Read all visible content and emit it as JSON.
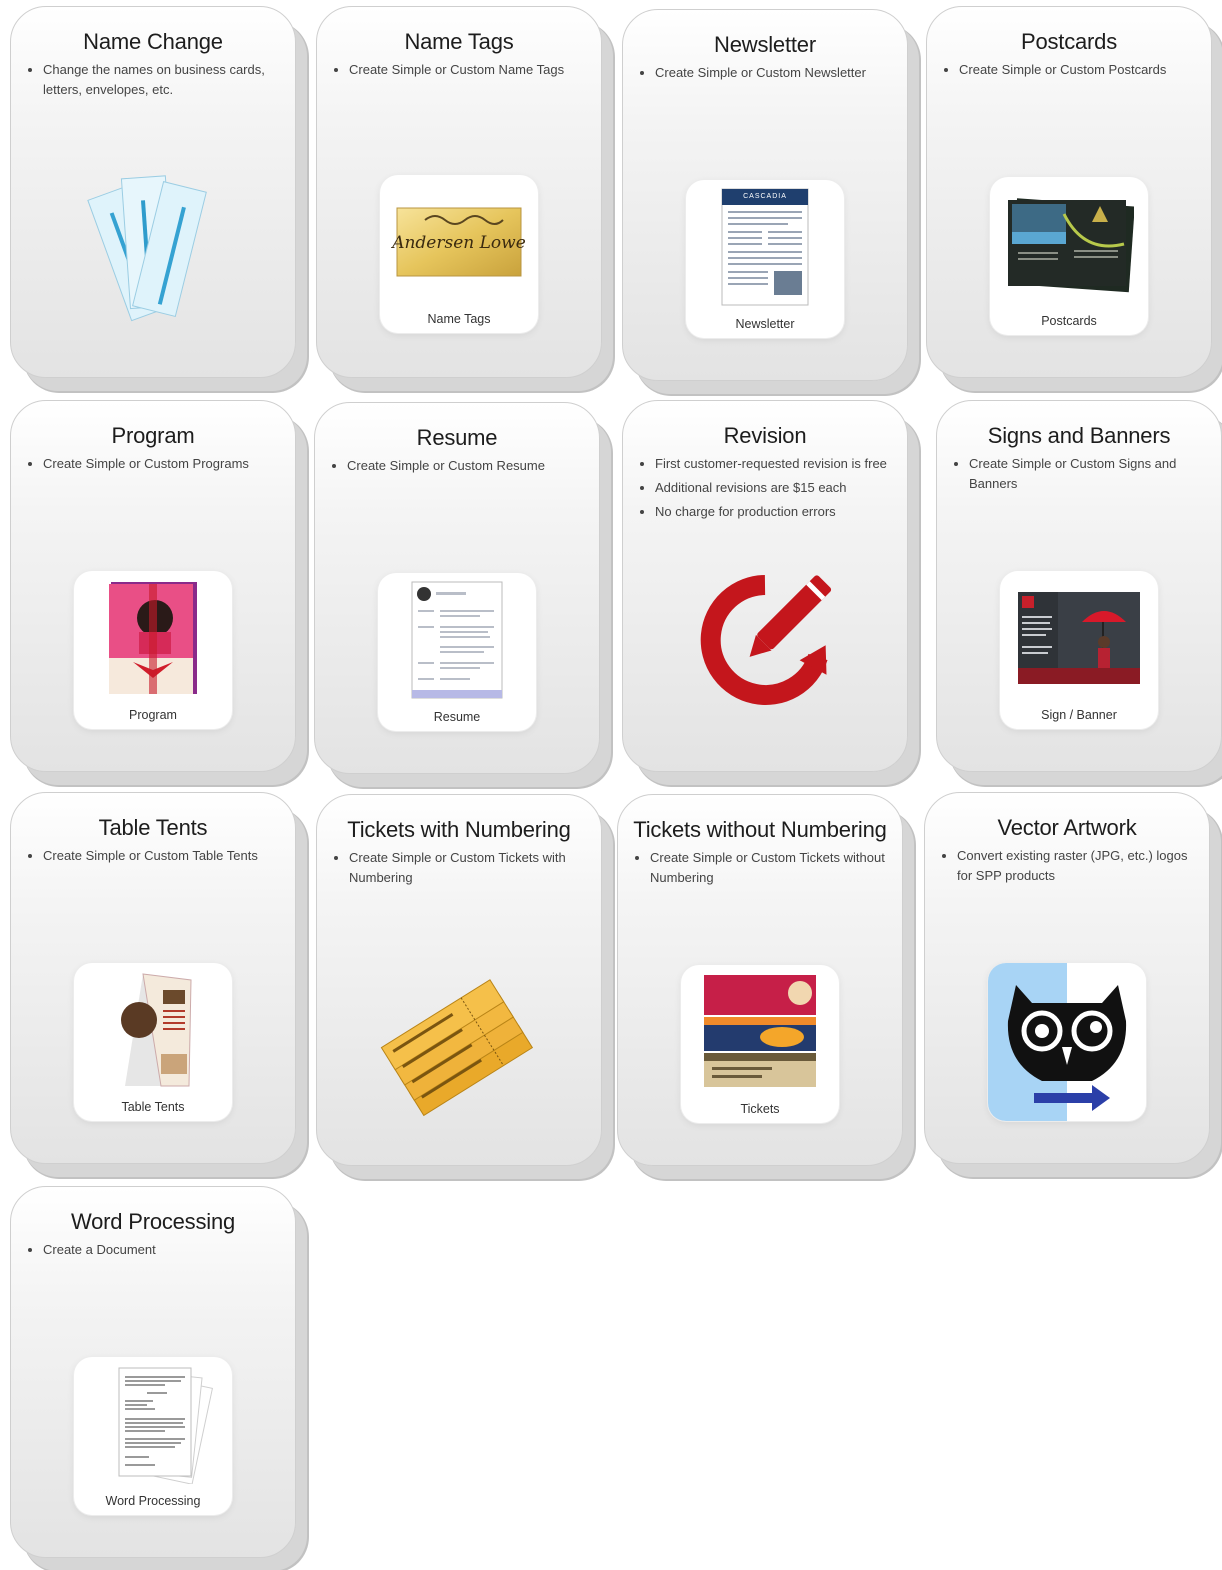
{
  "cards": [
    {
      "title": "Name Change",
      "bullets": [
        "Change the names on business cards, letters, envelopes, etc."
      ],
      "thumb_label": "",
      "icon": "business-cards-icon"
    },
    {
      "title": "Name Tags",
      "bullets": [
        "Create Simple or Custom Name Tags"
      ],
      "thumb_label": "Name Tags",
      "thumb_text": "Andersen Lowe",
      "icon": "name-tag-icon"
    },
    {
      "title": "Newsletter",
      "bullets": [
        "Create Simple or Custom Newsletter"
      ],
      "thumb_label": "Newsletter",
      "thumb_text": "CASCADIA",
      "icon": "newsletter-icon"
    },
    {
      "title": "Postcards",
      "bullets": [
        "Create Simple or Custom Postcards"
      ],
      "thumb_label": "Postcards",
      "icon": "postcard-icon"
    },
    {
      "title": "Program",
      "bullets": [
        "Create Simple or Custom Programs"
      ],
      "thumb_label": "Program",
      "icon": "program-icon"
    },
    {
      "title": "Resume",
      "bullets": [
        "Create Simple or Custom Resume"
      ],
      "thumb_label": "Resume",
      "icon": "resume-icon"
    },
    {
      "title": "Revision",
      "bullets": [
        "First customer-requested revision is free",
        "Additional revisions are $15 each",
        "No charge for production errors"
      ],
      "thumb_label": "",
      "icon": "revision-pencil-icon"
    },
    {
      "title": "Signs and Banners",
      "bullets": [
        "Create Simple or Custom Signs and Banners"
      ],
      "thumb_label": "Sign / Banner",
      "icon": "sign-banner-icon"
    },
    {
      "title": "Table Tents",
      "bullets": [
        "Create Simple or Custom Table Tents"
      ],
      "thumb_label": "Table Tents",
      "icon": "table-tent-icon"
    },
    {
      "title": "Tickets with Numbering",
      "bullets": [
        "Create Simple or Custom Tickets with Numbering"
      ],
      "thumb_label": "",
      "icon": "numbered-tickets-icon"
    },
    {
      "title": "Tickets without Numbering",
      "bullets": [
        "Create Simple or Custom Tickets without Numbering"
      ],
      "thumb_label": "Tickets",
      "icon": "tickets-icon"
    },
    {
      "title": "Vector Artwork",
      "bullets": [
        "Convert existing raster (JPG, etc.) logos for SPP products"
      ],
      "thumb_label": "",
      "icon": "vector-owl-icon"
    },
    {
      "title": "Word Processing",
      "bullets": [
        "Create a Document"
      ],
      "thumb_label": "Word Processing",
      "icon": "document-stack-icon"
    }
  ],
  "colors": {
    "revision_red": "#c4161c",
    "vector_blue": "#2b3fa8",
    "ticket_gold": "#f0b73a",
    "newsletter_navy": "#1f3f6e"
  }
}
